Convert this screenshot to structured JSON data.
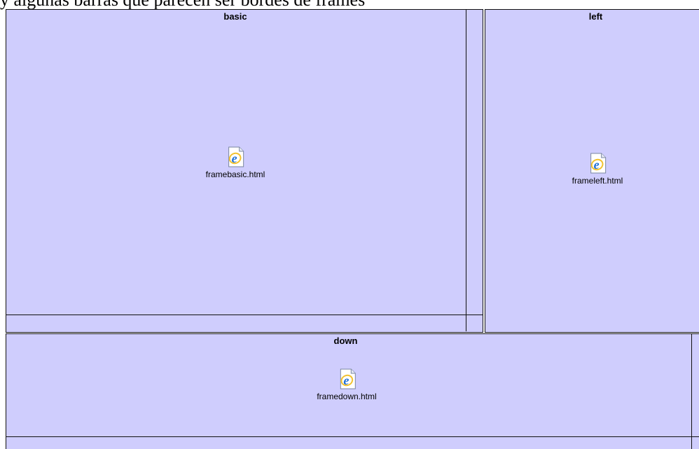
{
  "header": {
    "text": "y algunas barras que parecen ser bordes de frames"
  },
  "frames": {
    "basic": {
      "title": "basic",
      "file": "framebasic.html"
    },
    "left": {
      "title": "left",
      "file": "frameleft.html"
    },
    "down": {
      "title": "down",
      "file": "framedown.html"
    }
  },
  "icons": {
    "file_icon": "ie-document-icon"
  },
  "colors": {
    "frame_bg": "#cfcdfd",
    "border": "#111111",
    "icon_blue": "#1f6fd6"
  }
}
